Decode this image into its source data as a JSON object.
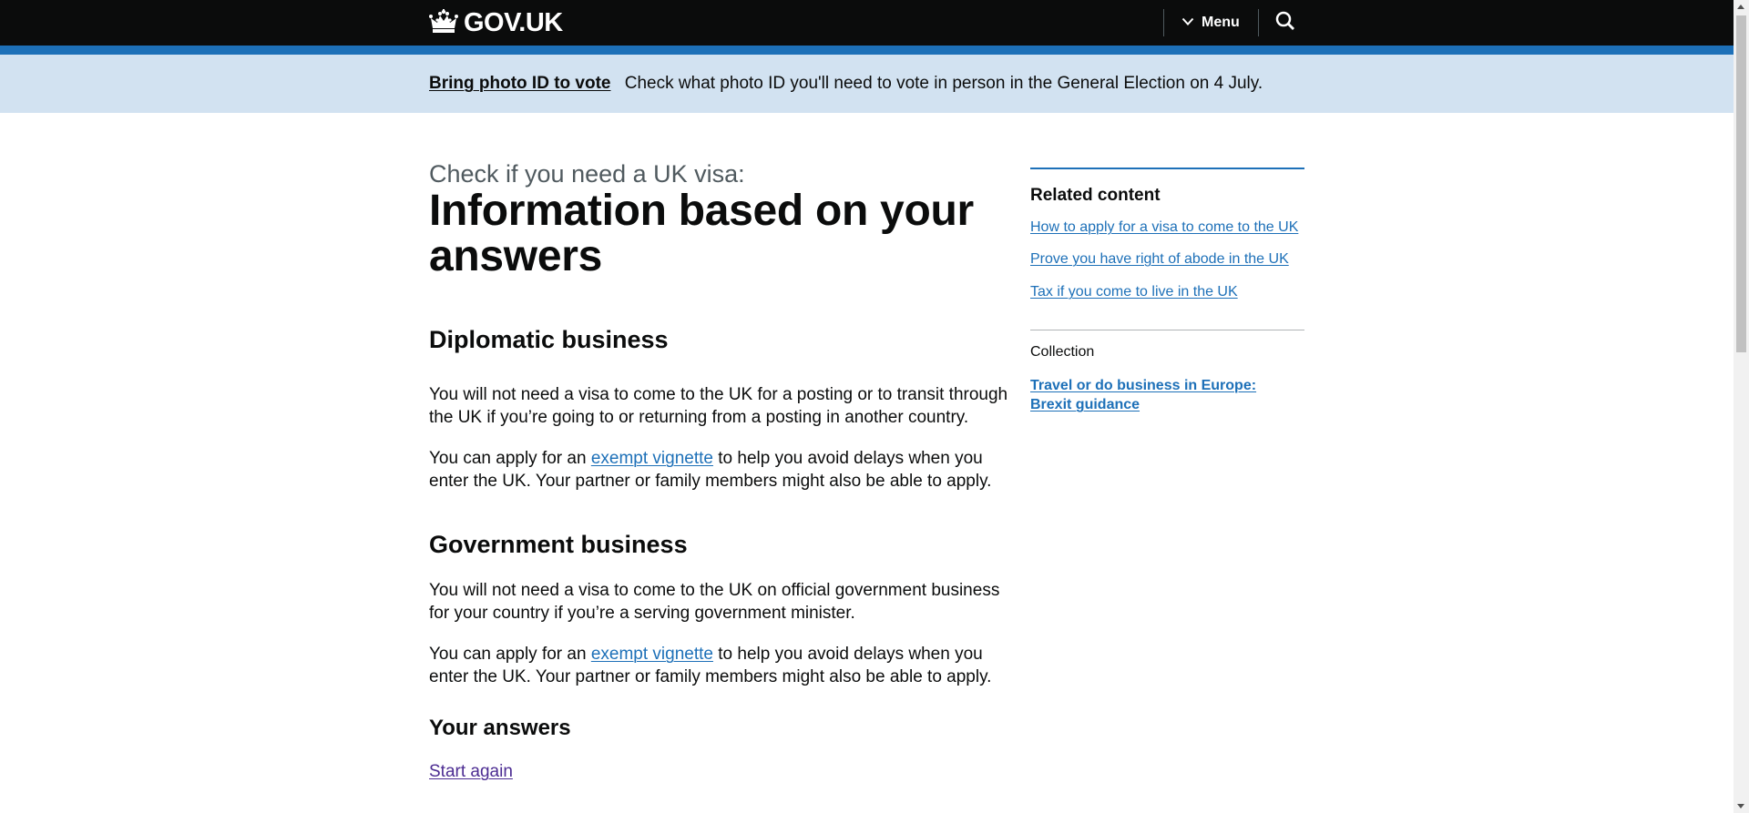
{
  "header": {
    "logo_text": "GOV.UK",
    "logo_icon": "crown-icon",
    "menu_label": "Menu",
    "menu_icon": "chevron-down-icon",
    "search_icon": "search-icon"
  },
  "banner": {
    "link_text": "Bring photo ID to vote",
    "text": "Check what photo ID you'll need to vote in person in the General Election on 4 July."
  },
  "main": {
    "caption": "Check if you need a UK visa:",
    "title": "Information based on your answers",
    "sections": [
      {
        "heading": "Diplomatic business",
        "para1": "You will not need a visa to come to the UK for a posting or to transit through the UK if you’re going to or returning from a posting in another country.",
        "para2_before": "You can apply for an ",
        "para2_link": "exempt vignette",
        "para2_after": " to help you avoid delays when you enter the UK. Your partner or family members might also be able to apply."
      },
      {
        "heading": "Government business",
        "para1": "You will not need a visa to come to the UK on official government business for your country if you’re a serving government minister.",
        "para2_before": "You can apply for an ",
        "para2_link": "exempt vignette",
        "para2_after": " to help you avoid delays when you enter the UK. Your partner or family members might also be able to apply."
      }
    ],
    "answers_heading": "Your answers",
    "start_again": "Start again"
  },
  "sidebar": {
    "heading": "Related content",
    "links": [
      "How to apply for a visa to come to the UK",
      "Prove you have right of abode in the UK",
      "Tax if you come to live in the UK"
    ],
    "collection_label": "Collection",
    "collection_link": "Travel or do business in Europe: Brexit guidance"
  },
  "colors": {
    "header_bg": "#0b0c0c",
    "brand_blue": "#1d70b8",
    "banner_bg": "#d2e2f1",
    "link": "#1d70b8",
    "visited_link": "#4c2c92",
    "secondary_text": "#505a5f"
  }
}
